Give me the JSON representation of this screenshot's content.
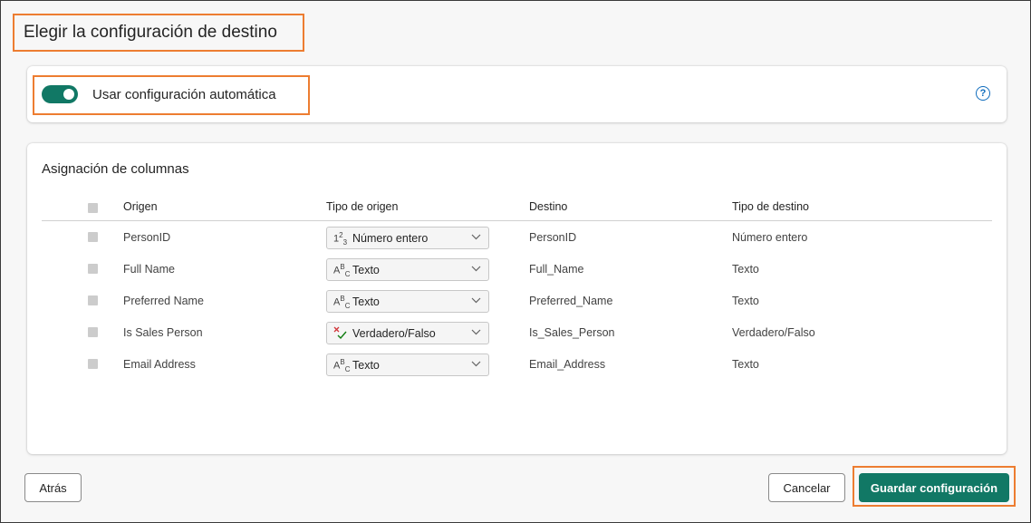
{
  "header": {
    "title": "Elegir la configuración de destino"
  },
  "auto_settings": {
    "label": "Usar configuración automática",
    "enabled": true,
    "help_symbol": "?"
  },
  "column_mapping": {
    "title": "Asignación de columnas",
    "headers": {
      "source": "Origen",
      "source_type": "Tipo de origen",
      "destination": "Destino",
      "destination_type": "Tipo de destino"
    },
    "rows": [
      {
        "source": "PersonID",
        "source_type": "Número entero",
        "type_icon": "whole-number-icon",
        "destination": "PersonID",
        "destination_type": "Número entero"
      },
      {
        "source": "Full Name",
        "source_type": "Texto",
        "type_icon": "text-type-icon",
        "destination": "Full_Name",
        "destination_type": "Texto"
      },
      {
        "source": "Preferred Name",
        "source_type": "Texto",
        "type_icon": "text-type-icon",
        "destination": "Preferred_Name",
        "destination_type": "Texto"
      },
      {
        "source": "Is Sales Person",
        "source_type": "Verdadero/Falso",
        "type_icon": "boolean-type-icon",
        "destination": "Is_Sales_Person",
        "destination_type": "Verdadero/Falso"
      },
      {
        "source": "Email Address",
        "source_type": "Texto",
        "type_icon": "text-type-icon",
        "destination": "Email_Address",
        "destination_type": "Texto"
      }
    ]
  },
  "footer": {
    "back_label": "Atrás",
    "cancel_label": "Cancelar",
    "save_label": "Guardar configuración"
  },
  "colors": {
    "accent": "#117865",
    "highlight": "#ed7d31",
    "help": "#0f6cbd"
  }
}
